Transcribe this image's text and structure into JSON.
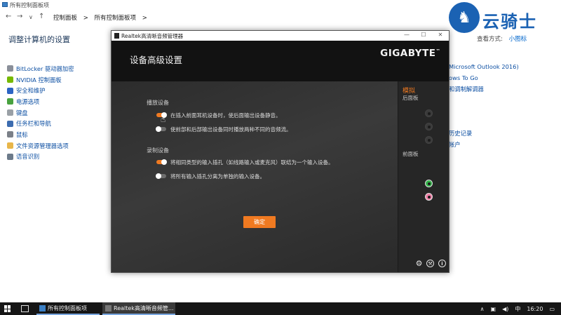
{
  "controlPanel": {
    "windowTitle": "所有控制面板项",
    "nav": {
      "back": "←",
      "forward": "→",
      "down": "∨",
      "up": "↑"
    },
    "breadcrumbs": [
      "控制面板",
      ">",
      "所有控制面板项",
      ">"
    ],
    "pageTitle": "调整计算机的设置",
    "viewByLabel": "查看方式:",
    "viewByValue": "小图标",
    "leftItems": [
      {
        "label": "BitLocker 驱动器加密",
        "color": "#8a8f99"
      },
      {
        "label": "NVIDIA 控制面板",
        "color": "#76b900"
      },
      {
        "label": "安全和维护",
        "color": "#2b64c4"
      },
      {
        "label": "电源选项",
        "color": "#48a23f"
      },
      {
        "label": "键盘",
        "color": "#9aa0a6"
      },
      {
        "label": "任务栏和导航",
        "color": "#3c6cb0"
      },
      {
        "label": "鼠标",
        "color": "#7b8088"
      },
      {
        "label": "文件资源管理器选项",
        "color": "#e8b64a"
      },
      {
        "label": "语音识别",
        "color": "#6c7a8a"
      }
    ],
    "rightItems": [
      {
        "label": "Microsoft Outlook 2016)",
        "row": 0
      },
      {
        "label": "ows To Go",
        "row": 1
      },
      {
        "label": "和调制解调器",
        "row": 2
      },
      {
        "label": "历史记录",
        "row": 6
      },
      {
        "label": "帐户",
        "row": 7
      }
    ]
  },
  "watermark": {
    "text": "云骑士",
    "icon": "knight-icon"
  },
  "realtek": {
    "windowTitle": "Realtek高清晰音频管理器",
    "controls": {
      "minimize": "—",
      "maximize": "☐",
      "close": "✕"
    },
    "header": "设备高级设置",
    "brand": "GIGABYTE",
    "playback": {
      "title": "播放设备",
      "options": [
        {
          "label": "在插入前面耳机设备时，使后面输出设备静音。",
          "on": true
        },
        {
          "label": "使前部和后部输出设备同时播放两种不同的音频流。",
          "on": false
        }
      ]
    },
    "recording": {
      "title": "录制设备",
      "options": [
        {
          "label": "将相同类型的输入插孔（如线路输入或麦克风）联结为一个输入设备。",
          "on": true
        },
        {
          "label": "将所有输入插孔分离为单独的输入设备。",
          "on": false
        }
      ]
    },
    "okButton": "确定",
    "side": {
      "tab": "模拟",
      "rearPanel": "后面板",
      "frontPanel": "前面板",
      "rearJacks": [
        "#4a4a4a",
        "#3a3a3a",
        "#4a3a3a"
      ],
      "frontJacks": [
        "#34b34a",
        "#ef7ea5"
      ],
      "icons": [
        "gear-icon",
        "wrench-icon",
        "info-icon"
      ],
      "infoGlyph": "i"
    }
  },
  "taskbar": {
    "tasks": [
      {
        "label": "所有控制面板项"
      },
      {
        "label": "Realtek高清晰音频管..."
      }
    ],
    "tray": {
      "chevron": "∧",
      "ime": "中",
      "time": "16:20"
    }
  }
}
